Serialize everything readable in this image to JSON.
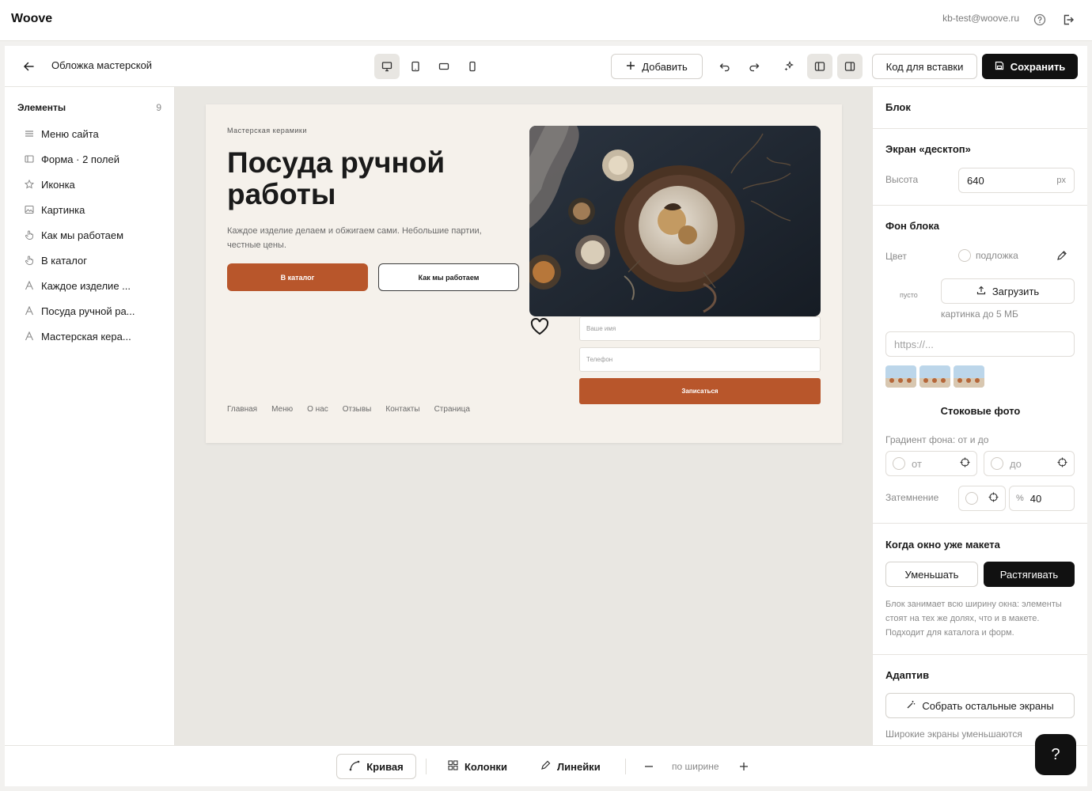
{
  "app": {
    "logo": "Woove",
    "user_email": "kb-test@woove.ru"
  },
  "toolbar": {
    "page_name": "Обложка мастерской",
    "add_label": "Добавить",
    "embed_label": "Код для вставки",
    "save_label": "Сохранить"
  },
  "elements": {
    "heading": "Элементы",
    "count": "9",
    "items": [
      {
        "label": "Меню сайта",
        "icon": "menu-icon"
      },
      {
        "label": "Форма · 2 полей",
        "icon": "form-icon"
      },
      {
        "label": "Иконка",
        "icon": "star-icon"
      },
      {
        "label": "Картинка",
        "icon": "image-icon"
      },
      {
        "label": "Как мы работаем",
        "icon": "hand-icon"
      },
      {
        "label": "В каталог",
        "icon": "hand-icon"
      },
      {
        "label": "Каждое изделие ...",
        "icon": "text-icon"
      },
      {
        "label": "Посуда ручной ра...",
        "icon": "text-icon"
      },
      {
        "label": "Мастерская кера...",
        "icon": "text-icon"
      }
    ]
  },
  "artboard": {
    "eyebrow": "Мастерская керамики",
    "title": "Посуда ручной работы",
    "description": "Каждое изделие делаем и обжигаем сами. Небольшие партии, честные цены.",
    "primary_button": "В каталог",
    "secondary_button": "Как мы работаем",
    "name_placeholder": "Ваше имя",
    "phone_placeholder": "Телефон",
    "submit_label": "Записаться",
    "nav": [
      "Главная",
      "Меню",
      "О нас",
      "Отзывы",
      "Контакты",
      "Страница"
    ],
    "accent_color": "#b8562b"
  },
  "properties": {
    "block_heading": "Блок",
    "screen_heading": "Экран «десктоп»",
    "height_label": "Высота",
    "height_value": "640",
    "height_unit": "px",
    "bg_heading": "Фон блока",
    "color_label": "Цвет",
    "color_value": "подложка",
    "empty_label": "пусто",
    "upload_label": "Загрузить",
    "upload_hint": "картинка до 5 МБ",
    "url_placeholder": "https://...",
    "stock_label": "Стоковые фото",
    "gradient_label": "Градиент фона: от и до",
    "gradient_from": "от",
    "gradient_to": "до",
    "dim_label": "Затемнение",
    "dim_unit": "%",
    "dim_value": "40",
    "window_heading": "Когда окно уже макета",
    "shrink_label": "Уменьшать",
    "stretch_label": "Растягивать",
    "window_hint": "Блок занимает всю ширину окна: элементы стоят на тех же долях, что и в макете. Подходит для каталога и форм.",
    "adaptive_heading": "Адаптив",
    "collect_label": "Собрать остальные экраны",
    "adaptive_hint": "Широкие экраны уменьшаются"
  },
  "bottombar": {
    "curve_label": "Кривая",
    "columns_label": "Колонки",
    "rulers_label": "Линейки",
    "zoom_label": "по ширине",
    "help_label": "?"
  }
}
